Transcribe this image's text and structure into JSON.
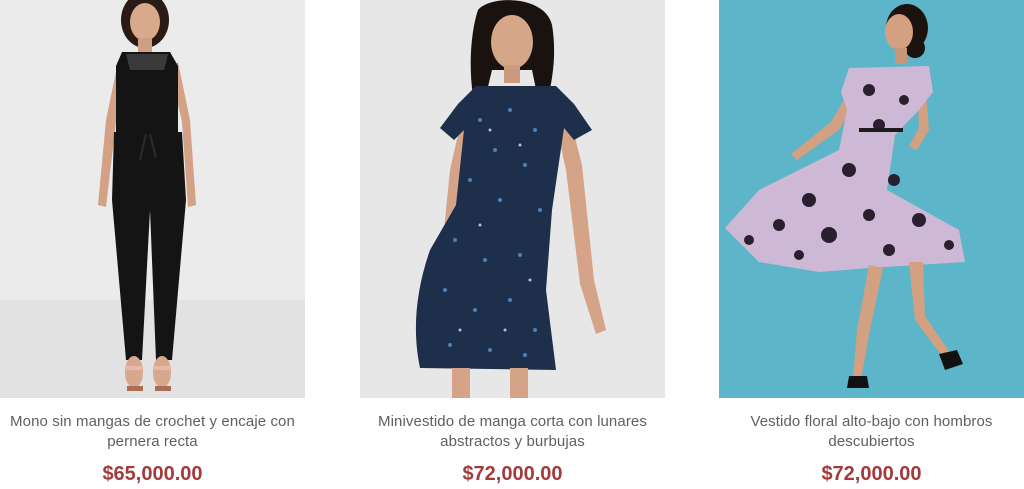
{
  "products": [
    {
      "title": "Mono sin mangas de crochet y encaje con pernera recta",
      "price": "$65,000.00",
      "image": {
        "background": "#e9e9e9",
        "garment": "#141414"
      }
    },
    {
      "title": "Minivestido de manga corta con lunares abstractos y burbujas",
      "price": "$72,000.00",
      "image": {
        "background": "#e6e6e6",
        "garment": "#1d2f4a"
      }
    },
    {
      "title": "Vestido floral alto-bajo con hombros descubiertos",
      "price": "$72,000.00",
      "image": {
        "background": "#5fb6c9",
        "garment": "#cdb8d6"
      }
    }
  ]
}
